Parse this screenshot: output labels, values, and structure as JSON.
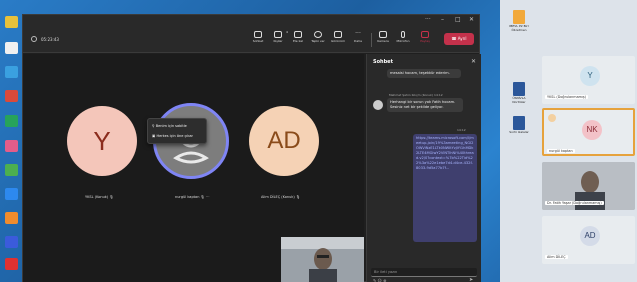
{
  "meeting": {
    "timer": "05:23:43",
    "toolbar": {
      "chat": "Sohbet",
      "people": "Kişiler",
      "people_count": "4",
      "raise": "Ele kal",
      "react": "Tepki ver",
      "view": "Görünüm",
      "more": "Daha",
      "camera": "Kamera",
      "mic": "Mikrofon",
      "share": "Paylaş",
      "leave": "Ayrıl"
    },
    "participants": [
      {
        "initials": "Y",
        "name": "YKSL (Konuk)"
      },
      {
        "initials": "",
        "name": "nurgül kaptan"
      },
      {
        "initials": "AD",
        "name": "Alim DİLEÇ (Konuk)"
      }
    ],
    "context_menu": [
      "Benim için sabitle",
      "Herkes için öne çıkar"
    ]
  },
  "chat": {
    "title": "Sohbet",
    "messages": [
      {
        "type": "in",
        "text": "mesaisi hocam, teşekkür ederim."
      },
      {
        "type": "meta",
        "text": "Mehmet Şahin Kılıçm (Konuk)  14:12"
      },
      {
        "type": "in",
        "text": "Herhangi bir sorun yok Fatih hocam. Sesiniz net bir şekilde geliyor."
      },
      {
        "type": "meta",
        "text": "14:12"
      },
      {
        "type": "out",
        "text": "https://teams.microsoft.com/l/meetup-join/19%3ameeting_NGI2OWViNzE1LTk0NWItYzJiYi1hMDk2LTE4MGIwY2VlNTlhNi%40thread.v2/0?context=%7b%22Tid%22%3a%22e1ebe7d4-d4ce-432f-8033-9d5a77b7f..."
      }
    ],
    "compose_placeholder": "Bir ileti yazın"
  },
  "side_tiles": [
    {
      "initials": "Y",
      "name": "YKSL (Doğrulanmamış)"
    },
    {
      "initials": "NK",
      "name": "nurgül kaptan"
    },
    {
      "initials": "",
      "name": "Dr. Fatih Yaşar (Doğrulanmamış)"
    },
    {
      "initials": "AD",
      "name": "Alim DİLEÇ"
    }
  ],
  "desktop": {
    "right_icons": [
      "IBEVL P2 Birl Öbretmen",
      "ÜSNİVLA Nortlüler",
      "Sorhi ikalalar"
    ]
  }
}
